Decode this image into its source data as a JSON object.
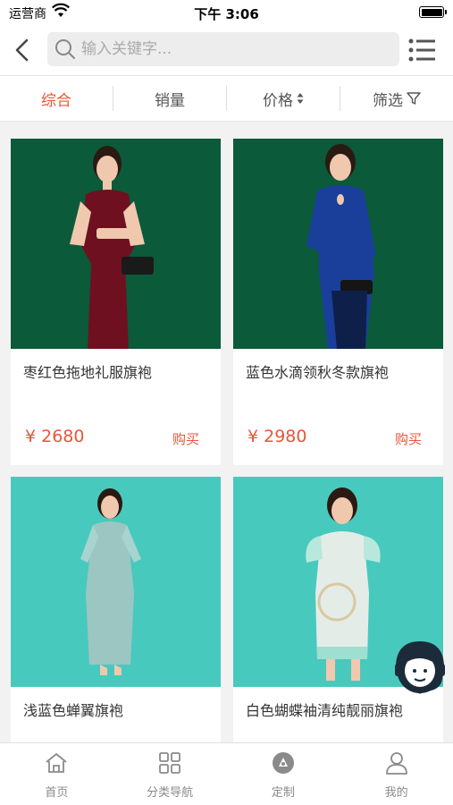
{
  "status_bar": {
    "carrier": "运营商",
    "time": "下午 3:06"
  },
  "search": {
    "placeholder": "输入关键字..."
  },
  "filters": [
    {
      "label": "综合",
      "active": true
    },
    {
      "label": "销量",
      "active": false
    },
    {
      "label": "价格",
      "active": false
    },
    {
      "label": "筛选",
      "active": false
    }
  ],
  "products": [
    {
      "title": "枣红色拖地礼服旗袍",
      "price": "¥ 2680",
      "buy_label": "购买",
      "bg": "#0b5a3a",
      "dress": "#6e1020"
    },
    {
      "title": "蓝色水滴领秋冬款旗袍",
      "price": "¥ 2980",
      "buy_label": "购买",
      "bg": "#0b5a3a",
      "dress": "#1a3f9a"
    },
    {
      "title": "浅蓝色蝉翼旗袍",
      "price": "",
      "buy_label": "",
      "bg": "#48c9bd",
      "dress": "#9cc6c2"
    },
    {
      "title": "白色蝴蝶袖清纯靓丽旗袍",
      "price": "",
      "buy_label": "",
      "bg": "#48c9bd",
      "dress": "#e4ece8"
    }
  ],
  "tabs": [
    {
      "label": "首页",
      "icon": "home-icon"
    },
    {
      "label": "分类导航",
      "icon": "category-icon"
    },
    {
      "label": "定制",
      "icon": "customize-icon"
    },
    {
      "label": "我的",
      "icon": "user-icon"
    }
  ],
  "colors": {
    "accent": "#e8553a",
    "green_bg": "#0b5a3a",
    "teal_bg": "#48c9bd"
  }
}
